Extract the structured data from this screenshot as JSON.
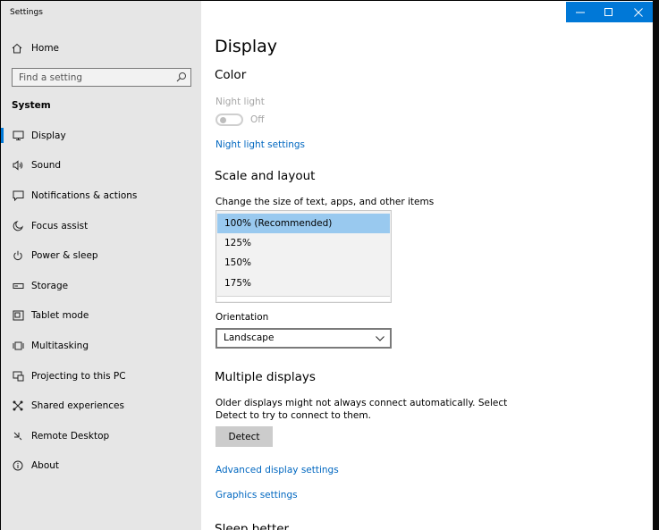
{
  "window": {
    "title": "Settings"
  },
  "sidebar": {
    "home": "Home",
    "search_placeholder": "Find a setting",
    "section": "System",
    "items": [
      {
        "label": "Display",
        "icon": "monitor-icon",
        "active": true
      },
      {
        "label": "Sound",
        "icon": "speaker-icon"
      },
      {
        "label": "Notifications & actions",
        "icon": "notification-icon"
      },
      {
        "label": "Focus assist",
        "icon": "moon-icon"
      },
      {
        "label": "Power & sleep",
        "icon": "power-icon"
      },
      {
        "label": "Storage",
        "icon": "storage-icon"
      },
      {
        "label": "Tablet mode",
        "icon": "tablet-icon"
      },
      {
        "label": "Multitasking",
        "icon": "multitasking-icon"
      },
      {
        "label": "Projecting to this PC",
        "icon": "projecting-icon"
      },
      {
        "label": "Shared experiences",
        "icon": "shared-experiences-icon"
      },
      {
        "label": "Remote Desktop",
        "icon": "remote-desktop-icon"
      },
      {
        "label": "About",
        "icon": "info-icon"
      }
    ]
  },
  "main": {
    "title": "Display",
    "color": {
      "heading": "Color",
      "night_light_label": "Night light",
      "toggle_state": "Off",
      "night_light_link": "Night light settings"
    },
    "scale": {
      "heading": "Scale and layout",
      "description": "Change the size of text, apps, and other items",
      "options": [
        "100% (Recommended)",
        "125%",
        "150%",
        "175%"
      ],
      "selected_index": 0,
      "orientation_label": "Orientation",
      "orientation_value": "Landscape"
    },
    "multiple": {
      "heading": "Multiple displays",
      "desc_line1": "Older displays might not always connect automatically. Select",
      "desc_line2": "Detect to try to connect to them.",
      "detect": "Detect",
      "advanced_link": "Advanced display settings",
      "graphics_link": "Graphics settings",
      "next_heading": "Sleep better"
    }
  },
  "colors": {
    "accent": "#0078d7",
    "link": "#0067c0",
    "selection": "#99c9ef"
  }
}
